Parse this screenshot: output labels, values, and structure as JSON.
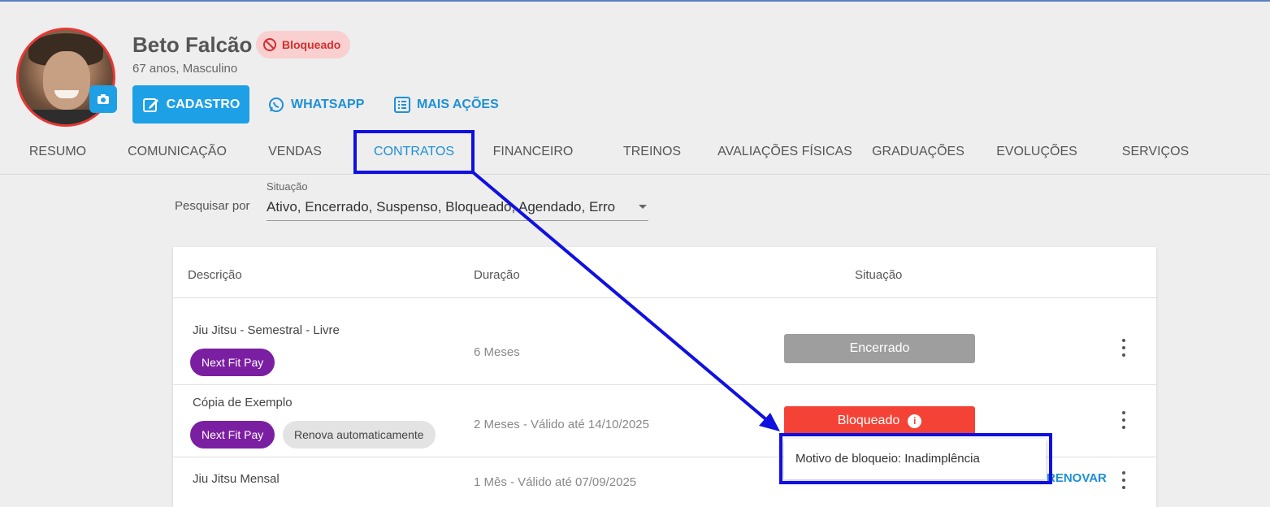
{
  "profile": {
    "name": "Beto Falcão",
    "status_badge": "Bloqueado",
    "age_gender": "67 anos, Masculino"
  },
  "actions": {
    "cadastro": "CADASTRO",
    "whatsapp": "WHATSAPP",
    "mais_acoes": "MAIS AÇÕES"
  },
  "tabs": [
    {
      "label": "RESUMO"
    },
    {
      "label": "COMUNICAÇÃO"
    },
    {
      "label": "VENDAS"
    },
    {
      "label": "CONTRATOS"
    },
    {
      "label": "FINANCEIRO"
    },
    {
      "label": "TREINOS"
    },
    {
      "label": "AVALIAÇÕES FÍSICAS"
    },
    {
      "label": "GRADUAÇÕES"
    },
    {
      "label": "EVOLUÇÕES"
    },
    {
      "label": "SERVIÇOS"
    }
  ],
  "active_tab": "CONTRATOS",
  "filter": {
    "label": "Pesquisar por",
    "field_label": "Situação",
    "value": "Ativo, Encerrado, Suspenso, Bloqueado, Agendado, Erro"
  },
  "table": {
    "headers": {
      "descricao": "Descrição",
      "duracao": "Duração",
      "situacao": "Situação"
    },
    "rows": [
      {
        "descricao": "Jiu Jitsu - Semestral - Livre",
        "chips": [
          "Next Fit Pay"
        ],
        "duracao": "6 Meses",
        "situacao": "Encerrado"
      },
      {
        "descricao": "Cópia de Exemplo",
        "chips": [
          "Next Fit Pay",
          "Renova automaticamente"
        ],
        "duracao": "2 Meses - Válido até 14/10/2025",
        "situacao": "Bloqueado"
      },
      {
        "descricao": "Jiu Jitsu Mensal",
        "chips": [],
        "duracao": "1 Mês - Válido até 07/09/2025",
        "situacao": "",
        "action": "RENOVAR"
      }
    ]
  },
  "tooltip": {
    "text": "Motivo de bloqueio: Inadimplência"
  },
  "colors": {
    "primary": "#1ea0e6",
    "blocked": "#f44336",
    "ended": "#9e9e9e",
    "pay_chip": "#7b1fa2",
    "annotation": "#1010e0"
  }
}
